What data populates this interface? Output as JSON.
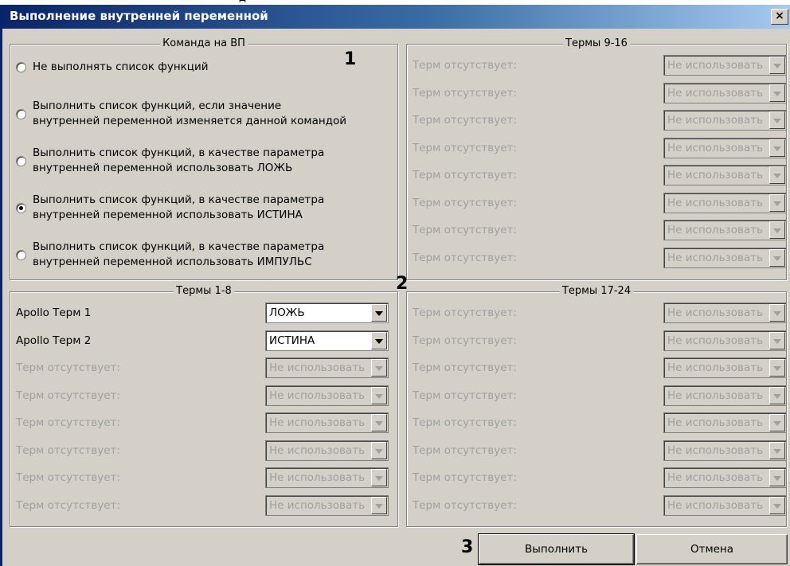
{
  "window": {
    "title": "Выполнение внутренней переменной",
    "close_label": "×"
  },
  "command_group": {
    "title": "Команда на ВП",
    "options": [
      {
        "label": "Не выполнять список функций",
        "checked": false
      },
      {
        "label": "Выполнить список функций, если значение\nвнутренней переменной изменяется данной командой",
        "checked": false
      },
      {
        "label": "Выполнить список функций, в качестве параметра\nвнутренней переменной использовать ЛОЖЬ",
        "checked": false
      },
      {
        "label": "Выполнить список функций, в качестве параметра\nвнутренней переменной использовать ИСТИНА",
        "checked": true
      },
      {
        "label": "Выполнить список функций, в качестве параметра\nвнутренней переменной использовать ИМПУЛЬС",
        "checked": false
      }
    ]
  },
  "terms_1_8": {
    "title": "Термы 1-8",
    "rows": [
      {
        "label": "Apollo Терм 1",
        "value": "ЛОЖЬ",
        "enabled": true
      },
      {
        "label": "Apollo Терм 2",
        "value": "ИСТИНА",
        "enabled": true
      },
      {
        "label": "Терм отсутствует:",
        "value": "Не использовать",
        "enabled": false
      },
      {
        "label": "Терм отсутствует:",
        "value": "Не использовать",
        "enabled": false
      },
      {
        "label": "Терм отсутствует:",
        "value": "Не использовать",
        "enabled": false
      },
      {
        "label": "Терм отсутствует:",
        "value": "Не использовать",
        "enabled": false
      },
      {
        "label": "Терм отсутствует:",
        "value": "Не использовать",
        "enabled": false
      },
      {
        "label": "Терм отсутствует:",
        "value": "Не использовать",
        "enabled": false
      }
    ]
  },
  "terms_9_16": {
    "title": "Термы 9-16",
    "rows": [
      {
        "label": "Терм отсутствует:",
        "value": "Не использовать",
        "enabled": false
      },
      {
        "label": "Терм отсутствует:",
        "value": "Не использовать",
        "enabled": false
      },
      {
        "label": "Терм отсутствует:",
        "value": "Не использовать",
        "enabled": false
      },
      {
        "label": "Терм отсутствует:",
        "value": "Не использовать",
        "enabled": false
      },
      {
        "label": "Терм отсутствует:",
        "value": "Не использовать",
        "enabled": false
      },
      {
        "label": "Терм отсутствует:",
        "value": "Не использовать",
        "enabled": false
      },
      {
        "label": "Терм отсутствует:",
        "value": "Не использовать",
        "enabled": false
      },
      {
        "label": "Терм отсутствует:",
        "value": "Не использовать",
        "enabled": false
      }
    ]
  },
  "terms_17_24": {
    "title": "Термы 17-24",
    "rows": [
      {
        "label": "Терм отсутствует:",
        "value": "Не использовать",
        "enabled": false
      },
      {
        "label": "Терм отсутствует:",
        "value": "Не использовать",
        "enabled": false
      },
      {
        "label": "Терм отсутствует:",
        "value": "Не использовать",
        "enabled": false
      },
      {
        "label": "Терм отсутствует:",
        "value": "Не использовать",
        "enabled": false
      },
      {
        "label": "Терм отсутствует:",
        "value": "Не использовать",
        "enabled": false
      },
      {
        "label": "Терм отсутствует:",
        "value": "Не использовать",
        "enabled": false
      },
      {
        "label": "Терм отсутствует:",
        "value": "Не использовать",
        "enabled": false
      },
      {
        "label": "Терм отсутствует:",
        "value": "Не использовать",
        "enabled": false
      }
    ]
  },
  "markers": {
    "m1": "1",
    "m2": "2",
    "m3": "3"
  },
  "buttons": {
    "execute": "Выполнить",
    "cancel": "Отмена"
  }
}
